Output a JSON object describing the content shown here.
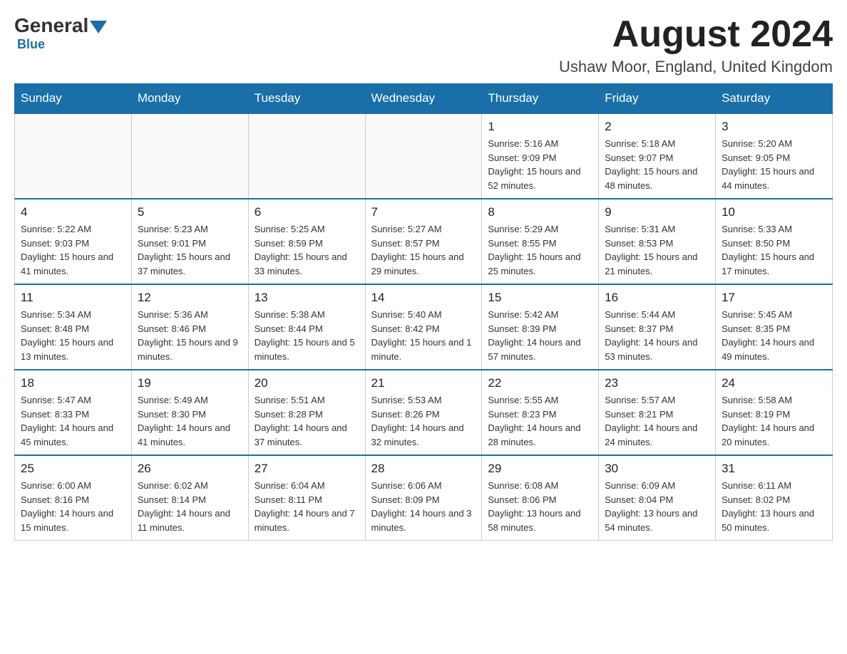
{
  "header": {
    "logo": {
      "general": "General",
      "blue": "Blue",
      "sub": "Blue"
    },
    "title": "August 2024",
    "location": "Ushaw Moor, England, United Kingdom"
  },
  "days_of_week": [
    "Sunday",
    "Monday",
    "Tuesday",
    "Wednesday",
    "Thursday",
    "Friday",
    "Saturday"
  ],
  "weeks": [
    [
      {
        "day": "",
        "info": ""
      },
      {
        "day": "",
        "info": ""
      },
      {
        "day": "",
        "info": ""
      },
      {
        "day": "",
        "info": ""
      },
      {
        "day": "1",
        "info": "Sunrise: 5:16 AM\nSunset: 9:09 PM\nDaylight: 15 hours and 52 minutes."
      },
      {
        "day": "2",
        "info": "Sunrise: 5:18 AM\nSunset: 9:07 PM\nDaylight: 15 hours and 48 minutes."
      },
      {
        "day": "3",
        "info": "Sunrise: 5:20 AM\nSunset: 9:05 PM\nDaylight: 15 hours and 44 minutes."
      }
    ],
    [
      {
        "day": "4",
        "info": "Sunrise: 5:22 AM\nSunset: 9:03 PM\nDaylight: 15 hours and 41 minutes."
      },
      {
        "day": "5",
        "info": "Sunrise: 5:23 AM\nSunset: 9:01 PM\nDaylight: 15 hours and 37 minutes."
      },
      {
        "day": "6",
        "info": "Sunrise: 5:25 AM\nSunset: 8:59 PM\nDaylight: 15 hours and 33 minutes."
      },
      {
        "day": "7",
        "info": "Sunrise: 5:27 AM\nSunset: 8:57 PM\nDaylight: 15 hours and 29 minutes."
      },
      {
        "day": "8",
        "info": "Sunrise: 5:29 AM\nSunset: 8:55 PM\nDaylight: 15 hours and 25 minutes."
      },
      {
        "day": "9",
        "info": "Sunrise: 5:31 AM\nSunset: 8:53 PM\nDaylight: 15 hours and 21 minutes."
      },
      {
        "day": "10",
        "info": "Sunrise: 5:33 AM\nSunset: 8:50 PM\nDaylight: 15 hours and 17 minutes."
      }
    ],
    [
      {
        "day": "11",
        "info": "Sunrise: 5:34 AM\nSunset: 8:48 PM\nDaylight: 15 hours and 13 minutes."
      },
      {
        "day": "12",
        "info": "Sunrise: 5:36 AM\nSunset: 8:46 PM\nDaylight: 15 hours and 9 minutes."
      },
      {
        "day": "13",
        "info": "Sunrise: 5:38 AM\nSunset: 8:44 PM\nDaylight: 15 hours and 5 minutes."
      },
      {
        "day": "14",
        "info": "Sunrise: 5:40 AM\nSunset: 8:42 PM\nDaylight: 15 hours and 1 minute."
      },
      {
        "day": "15",
        "info": "Sunrise: 5:42 AM\nSunset: 8:39 PM\nDaylight: 14 hours and 57 minutes."
      },
      {
        "day": "16",
        "info": "Sunrise: 5:44 AM\nSunset: 8:37 PM\nDaylight: 14 hours and 53 minutes."
      },
      {
        "day": "17",
        "info": "Sunrise: 5:45 AM\nSunset: 8:35 PM\nDaylight: 14 hours and 49 minutes."
      }
    ],
    [
      {
        "day": "18",
        "info": "Sunrise: 5:47 AM\nSunset: 8:33 PM\nDaylight: 14 hours and 45 minutes."
      },
      {
        "day": "19",
        "info": "Sunrise: 5:49 AM\nSunset: 8:30 PM\nDaylight: 14 hours and 41 minutes."
      },
      {
        "day": "20",
        "info": "Sunrise: 5:51 AM\nSunset: 8:28 PM\nDaylight: 14 hours and 37 minutes."
      },
      {
        "day": "21",
        "info": "Sunrise: 5:53 AM\nSunset: 8:26 PM\nDaylight: 14 hours and 32 minutes."
      },
      {
        "day": "22",
        "info": "Sunrise: 5:55 AM\nSunset: 8:23 PM\nDaylight: 14 hours and 28 minutes."
      },
      {
        "day": "23",
        "info": "Sunrise: 5:57 AM\nSunset: 8:21 PM\nDaylight: 14 hours and 24 minutes."
      },
      {
        "day": "24",
        "info": "Sunrise: 5:58 AM\nSunset: 8:19 PM\nDaylight: 14 hours and 20 minutes."
      }
    ],
    [
      {
        "day": "25",
        "info": "Sunrise: 6:00 AM\nSunset: 8:16 PM\nDaylight: 14 hours and 15 minutes."
      },
      {
        "day": "26",
        "info": "Sunrise: 6:02 AM\nSunset: 8:14 PM\nDaylight: 14 hours and 11 minutes."
      },
      {
        "day": "27",
        "info": "Sunrise: 6:04 AM\nSunset: 8:11 PM\nDaylight: 14 hours and 7 minutes."
      },
      {
        "day": "28",
        "info": "Sunrise: 6:06 AM\nSunset: 8:09 PM\nDaylight: 14 hours and 3 minutes."
      },
      {
        "day": "29",
        "info": "Sunrise: 6:08 AM\nSunset: 8:06 PM\nDaylight: 13 hours and 58 minutes."
      },
      {
        "day": "30",
        "info": "Sunrise: 6:09 AM\nSunset: 8:04 PM\nDaylight: 13 hours and 54 minutes."
      },
      {
        "day": "31",
        "info": "Sunrise: 6:11 AM\nSunset: 8:02 PM\nDaylight: 13 hours and 50 minutes."
      }
    ]
  ]
}
